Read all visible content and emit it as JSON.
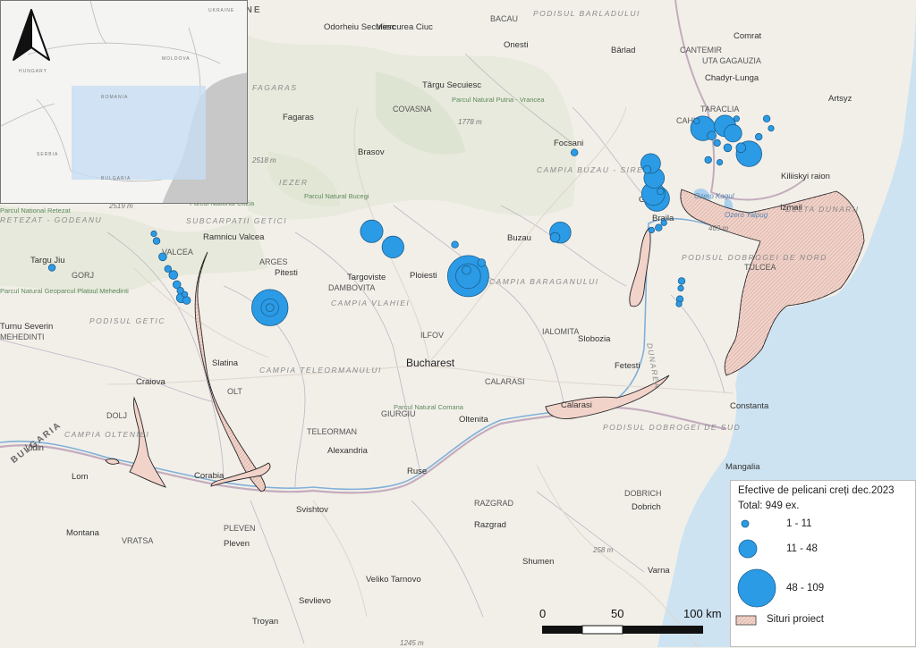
{
  "legend": {
    "title": "Efective de pelicani creți dec.2023",
    "total": "Total: 949 ex.",
    "classes": [
      {
        "label": "1 - 11",
        "color": "#2b9be6"
      },
      {
        "label": "11 - 48",
        "color": "#2b9be6"
      },
      {
        "label": "48 - 109",
        "color": "#2b9be6"
      }
    ],
    "sites_label": "Situri proiect"
  },
  "scale": {
    "zero": "0",
    "mid": "50",
    "end": "100 km"
  },
  "colors": {
    "point": "#2b9be6",
    "site_fill": "#f2d3ca",
    "site_stroke": "#222222",
    "sea": "#cde3f2",
    "land": "#f2efe9",
    "inset_extent": "#c7ddf2"
  },
  "north_arrow_icon": "north-arrow-icon",
  "map": {
    "countries": {
      "ukraine": "UKRAINE",
      "bulgaria": "BULGARIA"
    },
    "cities": {
      "odorheiu": "Odorheiu Secuiesc",
      "miercurea": "Miercurea Ciuc",
      "onesti": "Onesti",
      "barlad": "Bârlad",
      "comrat": "Comrat",
      "chadyr": "Chadyr-Lunga",
      "artsyz": "Artsyz",
      "targu_secuiesc": "Târgu Secuiesc",
      "fagaras": "Fagaras",
      "brasov": "Brasov",
      "focsani": "Focsani",
      "kiliiskyi": "Kiliiskyi raion",
      "izmail": "Izmail",
      "galati": "Galati",
      "braila": "Braila",
      "buzau": "Buzau",
      "ramnicu": "Ramnicu Valcea",
      "pitesti": "Pitesti",
      "targoviste": "Targoviste",
      "ploiesti": "Ploiesti",
      "targu_jiu": "Targu Jiu",
      "turnu": "Turnu Severin",
      "slobozia": "Slobozia",
      "slatina": "Slatina",
      "craiova": "Craiova",
      "fetesti": "Fetesti",
      "calarasi": "Calarasi",
      "oltenita": "Oltenita",
      "constanta": "Constanta",
      "vidin": "Vidin",
      "lom": "Lom",
      "corabia": "Corabia",
      "alexandria": "Alexandria",
      "ruse": "Ruse",
      "svishtov": "Svishtov",
      "razgrad": "Razgrad",
      "dobrich": "Dobrich",
      "mangalia": "Mangalia",
      "montana": "Montana",
      "pleven": "Pleven",
      "shumen": "Shumen",
      "varna": "Varna",
      "veliko": "Veliko Tarnovo",
      "sevlievo": "Sevlievo",
      "troyan": "Troyan",
      "tulcea": "TULCEA",
      "dolj": "DOLJ",
      "teleorman": "TELEORMAN",
      "gorj": "GORJ",
      "arges": "ARGES",
      "valcea": "VALCEA",
      "bacau": "BACAU",
      "covasna": "COVASNA",
      "cahul": "CAHUL",
      "cantemir": "CANTEMIR",
      "ialomita": "IALOMITA",
      "ilfov": "ILFOV",
      "giurgiu": "GIURGIU",
      "olt": "OLT",
      "dambovita": "DAMBOVITA",
      "calarasi_cty": "CALARASI",
      "mehedinti": "MEHEDINTI",
      "dobrich_cty": "DOBRICH",
      "razgrad_cty": "RAZGRAD",
      "pleven_cty": "PLEVEN",
      "vratsa": "VRATSA",
      "taraclia": "TARACLIA",
      "gagauzia": "UTA GAGAUZIA"
    },
    "capital": "Bucharest",
    "regions": {
      "barladului": "PODISUL BARLADULUI",
      "buzau_siret": "CAMPIA BUZAU - SIRET",
      "baraganului": "CAMPIA BARAGANULUI",
      "teleormanului": "CAMPIA TELEORMANULUI",
      "olteniei": "CAMPIA OLTENIEI",
      "dunarii": "DELTA DUNARII",
      "dobrogei_nord": "PODISUL DOBROGEI DE NORD",
      "dobrogei_sud": "PODISUL DOBROGEI DE SUD",
      "getic": "PODISUL GETIC",
      "subcarpatii": "SUBCARPATII GETICI",
      "retezat": "RETEZAT - GODEANU",
      "iezer": "IEZER",
      "vlahiei": "CAMPIA VLAHIEI",
      "fagaras_m": "FAGARAS",
      "dunarea": "DUNAREA"
    },
    "parks": {
      "putna": "Parcul Natural Putna - Vrancea",
      "buzau_park": "Parcul Natural Bucegi",
      "cozia": "Parcul National Cozia",
      "comana": "Parcul Natural Comana",
      "mehedinti_park": "Parcul Natural Geoparcul Platoul Mehedinti",
      "retezat_park": "Parcul National Retezat"
    },
    "elevations": {
      "e1778": "1778 m",
      "e2518": "2518 m",
      "e2519": "2519 m",
      "e469": "469 m",
      "e258": "258 m",
      "e1245": "1245 m"
    },
    "waters": {
      "kagul": "Ozero Kagul",
      "yalpuh": "Ozero Yalpug"
    },
    "inset": {
      "ukraine": "UKRAINE",
      "moldova": "MOLDOVA",
      "romania": "ROMANIA",
      "serbia": "SERBIA",
      "bulgaria": "BULGARIA",
      "hungary": "HUNGARY"
    }
  },
  "observations": [
    {
      "lon": 22.87,
      "lat": 43.99,
      "count": 3
    },
    {
      "lon": 24.02,
      "lat": 44.27,
      "count": 2
    },
    {
      "lon": 24.05,
      "lat": 44.21,
      "count": 3
    },
    {
      "lon": 24.12,
      "lat": 44.08,
      "count": 4
    },
    {
      "lon": 24.18,
      "lat": 43.98,
      "count": 3
    },
    {
      "lon": 24.24,
      "lat": 43.93,
      "count": 5
    },
    {
      "lon": 24.28,
      "lat": 43.85,
      "count": 4
    },
    {
      "lon": 24.32,
      "lat": 43.8,
      "count": 3
    },
    {
      "lon": 24.37,
      "lat": 43.77,
      "count": 2
    },
    {
      "lon": 24.33,
      "lat": 43.74,
      "count": 6
    },
    {
      "lon": 24.39,
      "lat": 43.72,
      "count": 4
    },
    {
      "lon": 25.33,
      "lat": 43.66,
      "count": 85
    },
    {
      "lon": 25.33,
      "lat": 43.66,
      "count": 20
    },
    {
      "lon": 25.33,
      "lat": 43.66,
      "count": 4
    },
    {
      "lon": 26.48,
      "lat": 44.29,
      "count": 33
    },
    {
      "lon": 26.72,
      "lat": 44.16,
      "count": 31
    },
    {
      "lon": 27.42,
      "lat": 44.18,
      "count": 3
    },
    {
      "lon": 27.55,
      "lat": 43.97,
      "count": 5
    },
    {
      "lon": 27.57,
      "lat": 43.92,
      "count": 109
    },
    {
      "lon": 27.57,
      "lat": 43.92,
      "count": 40
    },
    {
      "lon": 27.72,
      "lat": 44.03,
      "count": 4
    },
    {
      "lon": 28.61,
      "lat": 44.28,
      "count": 29
    },
    {
      "lon": 28.55,
      "lat": 44.24,
      "count": 6
    },
    {
      "lon": 28.77,
      "lat": 44.94,
      "count": 3
    },
    {
      "lon": 29.64,
      "lat": 44.3,
      "count": 2
    },
    {
      "lon": 29.72,
      "lat": 44.32,
      "count": 3
    },
    {
      "lon": 29.78,
      "lat": 44.36,
      "count": 2
    },
    {
      "lon": 29.98,
      "lat": 43.88,
      "count": 3
    },
    {
      "lon": 29.97,
      "lat": 43.82,
      "count": 2
    },
    {
      "lon": 29.96,
      "lat": 43.73,
      "count": 3
    },
    {
      "lon": 29.95,
      "lat": 43.69,
      "count": 2
    },
    {
      "lon": 29.59,
      "lat": 44.8,
      "count": 4
    },
    {
      "lon": 29.63,
      "lat": 44.85,
      "count": 25
    },
    {
      "lon": 29.67,
      "lat": 44.73,
      "count": 27
    },
    {
      "lon": 29.66,
      "lat": 44.6,
      "count": 35
    },
    {
      "lon": 29.7,
      "lat": 44.56,
      "count": 41
    },
    {
      "lon": 29.74,
      "lat": 44.62,
      "count": 3
    },
    {
      "lon": 30.22,
      "lat": 45.14,
      "count": 39
    },
    {
      "lon": 30.47,
      "lat": 45.16,
      "count": 30
    },
    {
      "lon": 30.56,
      "lat": 45.1,
      "count": 20
    },
    {
      "lon": 30.74,
      "lat": 44.93,
      "count": 42
    },
    {
      "lon": 30.32,
      "lat": 45.08,
      "count": 5
    },
    {
      "lon": 30.38,
      "lat": 45.02,
      "count": 3
    },
    {
      "lon": 30.5,
      "lat": 44.98,
      "count": 4
    },
    {
      "lon": 30.65,
      "lat": 44.98,
      "count": 6
    },
    {
      "lon": 30.6,
      "lat": 45.22,
      "count": 2
    },
    {
      "lon": 30.94,
      "lat": 45.22,
      "count": 3
    },
    {
      "lon": 30.99,
      "lat": 45.14,
      "count": 2
    },
    {
      "lon": 30.28,
      "lat": 44.88,
      "count": 3
    },
    {
      "lon": 30.41,
      "lat": 44.86,
      "count": 2
    },
    {
      "lon": 30.85,
      "lat": 45.07,
      "count": 3
    },
    {
      "lon": 30.15,
      "lat": 45.2,
      "count": 2
    }
  ]
}
